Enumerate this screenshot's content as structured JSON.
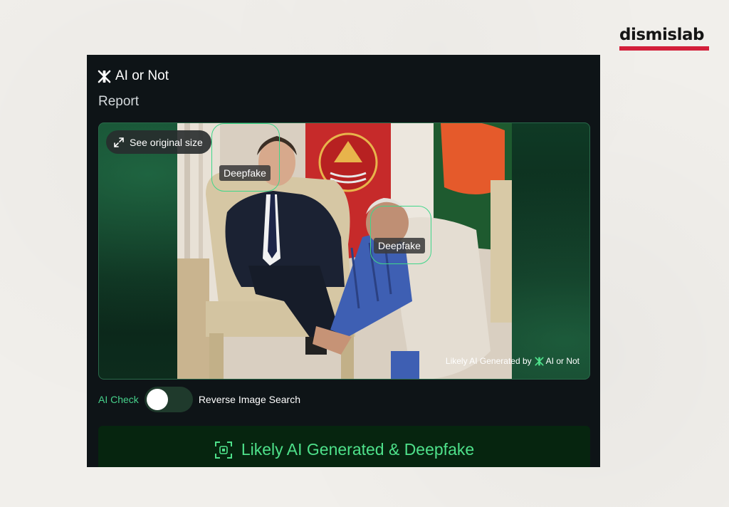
{
  "brand": {
    "name": "dismislab",
    "accent_color": "#d31f3a"
  },
  "app": {
    "title": "AI or Not",
    "logo_icon": "ai-or-not-logo-icon",
    "section_label": "Report"
  },
  "image_panel": {
    "see_original_label": "See original size",
    "expand_icon": "expand-icon",
    "detections": [
      {
        "label": "Deepfake"
      },
      {
        "label": "Deepfake"
      }
    ],
    "watermark": {
      "prefix": "Likely AI Generated by",
      "brand": "AI or Not"
    }
  },
  "toggle": {
    "left_label": "AI Check",
    "right_label": "Reverse Image Search",
    "active": "AI Check"
  },
  "verdict": {
    "icon": "scan-icon",
    "text": "Likely AI Generated & Deepfake",
    "color": "#4ee08a"
  }
}
